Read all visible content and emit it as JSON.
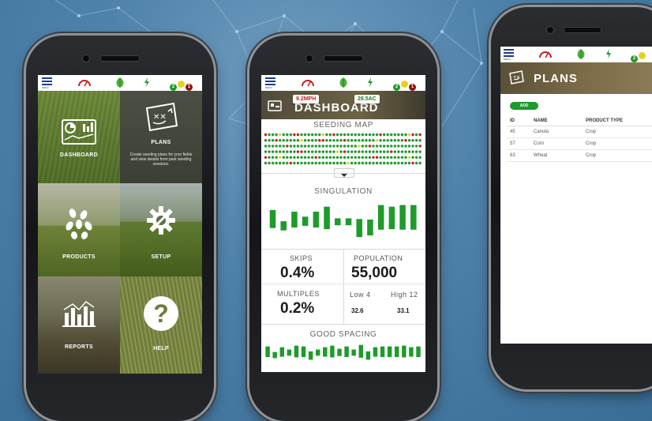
{
  "colors": {
    "accent_green": "#1e9b2b",
    "menu_blue": "#1a3c8c",
    "alert_red": "#c81e1e",
    "caution_yellow": "#e6d21e"
  },
  "status_bar": {
    "menu_label": "MENU",
    "dots": [
      "2",
      "",
      "1"
    ],
    "icons": [
      "speedometer-icon",
      "leaf-icon",
      "bolt-icon"
    ]
  },
  "phone1": {
    "tiles": [
      {
        "label": "DASHBOARD"
      },
      {
        "label": "PLANS",
        "description": "Create seeding plans for your fields and view details from past seeding sessions."
      },
      {
        "label": "PRODUCTS"
      },
      {
        "label": "SETUP"
      },
      {
        "label": "REPORTS"
      },
      {
        "label": "HELP"
      }
    ]
  },
  "phone2": {
    "speed": "9.2MPH",
    "area": "28.5AC",
    "header_title": "DASHBOARD",
    "seeding_map_title": "SEEDING MAP",
    "seeding_map_rows": [
      "rgggygggrrggggggyggrggggggggggggrgggggggyrg",
      "gggrggggggyggggrrgggggrggggggggygggggggrggg",
      "ggggggrgggggggggggggggggggyggrgggggggggggggr",
      "gggggggggrrgggggggggygrggggggggggggrgggggggg",
      "rgggygggggggggrgggggggggggggggrrggggggggygggg",
      "gggggggrgggggggggggggggygggggggggggggggggrgg"
    ],
    "singulation_title": "SINGULATION",
    "singulation_bars": [
      0.6,
      -0.2,
      0.5,
      0.2,
      0.5,
      0.8,
      0.1,
      0.1,
      -0.6,
      -0.5,
      0.9,
      0.8,
      0.9,
      0.9
    ],
    "skips_label": "SKIPS",
    "skips_value": "0.4%",
    "population_label": "POPULATION",
    "population_value": "55,000",
    "multiples_label": "MULTIPLES",
    "multiples_value": "0.2%",
    "low_label": "Low 4",
    "low_value": "32.6",
    "high_label": "High 12",
    "high_value": "33.1",
    "good_spacing_title": "GOOD SPACING",
    "spacing_bars": [
      0.6,
      -0.2,
      0.5,
      0.2,
      0.7,
      0.6,
      -0.4,
      0.2,
      0.5,
      0.7,
      0.3,
      0.6,
      0.2,
      0.8,
      -0.4,
      0.5,
      0.6,
      0.6,
      0.6,
      0.7,
      0.5,
      0.6
    ]
  },
  "phone3": {
    "title": "PLANS",
    "add_button": "ADD",
    "columns": [
      "ID",
      "NAME",
      "PRODUCT TYPE"
    ],
    "rows": [
      {
        "id": "45",
        "name": "Canola",
        "type": "Crop"
      },
      {
        "id": "57",
        "name": "Corn",
        "type": "Crop"
      },
      {
        "id": "63",
        "name": "Wheat",
        "type": "Crop"
      }
    ]
  }
}
